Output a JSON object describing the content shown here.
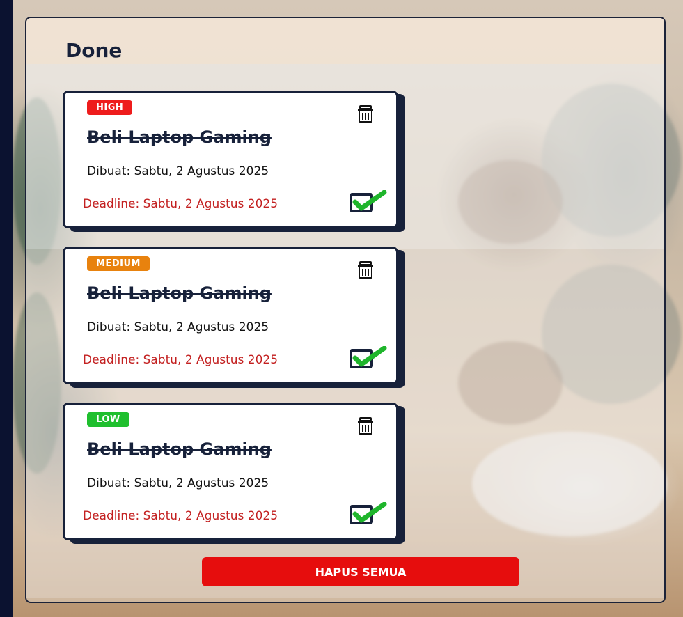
{
  "panel": {
    "title": "Done"
  },
  "tasks": [
    {
      "priority": "HIGH",
      "priority_color": "#ee1c1c",
      "title": "Beli Laptop Gaming",
      "created": "Dibuat: Sabtu, 2 Agustus 2025",
      "deadline": "Deadline: Sabtu, 2 Agustus 2025",
      "done": true
    },
    {
      "priority": "MEDIUM",
      "priority_color": "#e8820e",
      "title": "Beli Laptop Gaming",
      "created": "Dibuat: Sabtu, 2 Agustus 2025",
      "deadline": "Deadline: Sabtu, 2 Agustus 2025",
      "done": true
    },
    {
      "priority": "LOW",
      "priority_color": "#1fbf2e",
      "title": "Beli Laptop Gaming",
      "created": "Dibuat: Sabtu, 2 Agustus 2025",
      "deadline": "Deadline: Sabtu, 2 Agustus 2025",
      "done": true
    }
  ],
  "actions": {
    "delete_all_label": "HAPUS SEMUA"
  },
  "icons": {
    "delete": "trash-icon",
    "done": "checkbox-checked-icon"
  },
  "colors": {
    "accent_red": "#e60d0d",
    "navy": "#17213a",
    "check_green": "#1fb52c"
  }
}
